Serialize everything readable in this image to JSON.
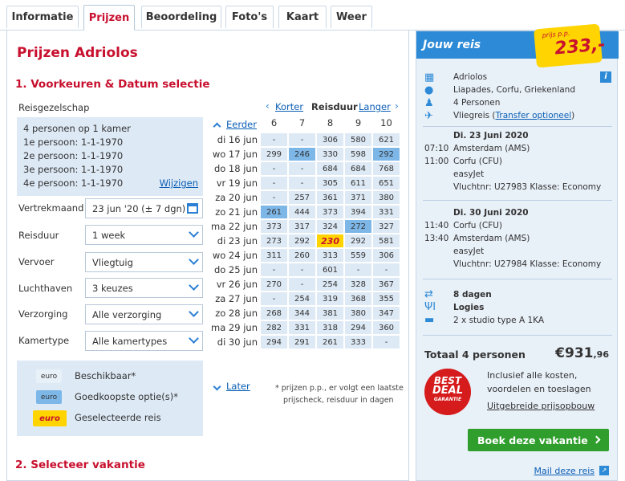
{
  "tabs": [
    {
      "label": "Informatie"
    },
    {
      "label": "Prijzen"
    },
    {
      "label": "Beoordeling"
    },
    {
      "label": "Foto's"
    },
    {
      "label": "Kaart"
    },
    {
      "label": "Weer"
    }
  ],
  "page_title": "Prijzen Adriolos",
  "section1": "1. Voorkeuren & Datum selectie",
  "section2": "2. Selecteer vakantie",
  "reisgezelschap": {
    "label": "Reisgezelschap",
    "line0": "4 personen op 1 kamer",
    "line1": "1e persoon: 1-1-1970",
    "line2": "2e persoon: 1-1-1970",
    "line3": "3e persoon: 1-1-1970",
    "line4": "4e persoon: 1-1-1970",
    "edit": "Wijzigen"
  },
  "fields": [
    {
      "label": "Vertrekmaand",
      "value": "23 jun '20 (± 7 dgn)"
    },
    {
      "label": "Reisduur",
      "value": "1 week"
    },
    {
      "label": "Vervoer",
      "value": "Vliegtuig"
    },
    {
      "label": "Luchthaven",
      "value": "3 keuzes"
    },
    {
      "label": "Verzorging",
      "value": "Alle verzorging"
    },
    {
      "label": "Kamertype",
      "value": "Alle kamertypes"
    }
  ],
  "legend": {
    "chip1": "euro",
    "text1": "Beschikbaar*",
    "chip2": "euro",
    "text2": "Goedkoopste optie(s)*",
    "chip3": "euro",
    "text3": "Geselecteerde reis"
  },
  "grid": {
    "korter": "Korter",
    "reisduur": "Reisduur",
    "langer": "Langer",
    "eerder": "Eerder",
    "later": "Later",
    "cols": [
      "6",
      "7",
      "8",
      "9",
      "10"
    ],
    "rows": [
      {
        "d": "di 16 jun",
        "v": [
          "-",
          "-",
          "306",
          "580",
          "621"
        ]
      },
      {
        "d": "wo 17 jun",
        "v": [
          "299",
          "246",
          "330",
          "598",
          "292"
        ]
      },
      {
        "d": "do 18 jun",
        "v": [
          "-",
          "-",
          "684",
          "684",
          "768"
        ]
      },
      {
        "d": "vr 19 jun",
        "v": [
          "-",
          "-",
          "305",
          "611",
          "651"
        ]
      },
      {
        "d": "za 20 jun",
        "v": [
          "-",
          "257",
          "361",
          "371",
          "380"
        ]
      },
      {
        "d": "zo 21 jun",
        "v": [
          "261",
          "444",
          "373",
          "394",
          "331"
        ]
      },
      {
        "d": "ma 22 jun",
        "v": [
          "373",
          "317",
          "324",
          "272",
          "327"
        ]
      },
      {
        "d": "di 23 jun",
        "v": [
          "273",
          "292",
          "230",
          "292",
          "581"
        ]
      },
      {
        "d": "wo 24 jun",
        "v": [
          "311",
          "260",
          "313",
          "559",
          "306"
        ]
      },
      {
        "d": "do 25 jun",
        "v": [
          "-",
          "-",
          "601",
          "-",
          "-"
        ]
      },
      {
        "d": "vr 26 jun",
        "v": [
          "270",
          "-",
          "254",
          "328",
          "367"
        ]
      },
      {
        "d": "za 27 jun",
        "v": [
          "-",
          "254",
          "319",
          "368",
          "355"
        ]
      },
      {
        "d": "zo 28 jun",
        "v": [
          "268",
          "344",
          "381",
          "380",
          "347"
        ]
      },
      {
        "d": "ma 29 jun",
        "v": [
          "282",
          "331",
          "318",
          "294",
          "360"
        ]
      },
      {
        "d": "di 30 jun",
        "v": [
          "294",
          "291",
          "261",
          "333",
          "-"
        ]
      }
    ],
    "note1": "* prijzen p.p., er volgt een laatste",
    "note2": "prijscheck, reisduur in dagen"
  },
  "side": {
    "title": "Jouw reis",
    "pp": "prijs p.p.",
    "price": "233,-",
    "hotel": "Adriolos",
    "location": "Liapades, Corfu, Griekenland",
    "persons": "4 Personen",
    "flight_prefix": "Vliegreis (",
    "flight_link": "Transfer optioneel",
    "flight_suffix": ")",
    "out": {
      "date": "Di. 23 Juni 2020",
      "t1": "07:10",
      "t2": "11:00",
      "from": "Amsterdam (AMS)",
      "to": "Corfu (CFU)",
      "airline": "easyJet",
      "info": "Vluchtnr: U27983 Klasse: Economy"
    },
    "ret": {
      "date": "Di. 30 Juni 2020",
      "t1": "11:40",
      "t2": "13:40",
      "from": "Corfu (CFU)",
      "to": "Amsterdam (AMS)",
      "airline": "easyJet",
      "info": "Vluchtnr: U27984 Klasse: Economy"
    },
    "days": "8 dagen",
    "board": "Logies",
    "room": "2 x studio type A 1KA",
    "total_label": "Totaal 4 personen",
    "total_main": "€931",
    "total_dec": ",96",
    "incl1": "Inclusief alle kosten,",
    "incl2": "voordelen en toeslagen",
    "breakdown": "Uitgebreide prijsopbouw",
    "deal1": "BEST",
    "deal2": "DEAL",
    "deal3": "GARANTIE",
    "book": "Boek deze vakantie",
    "mail": "Mail deze reis"
  },
  "colors": {
    "accent_red": "#c8102e",
    "blue": "#2d8ad6",
    "green": "#2f9e2c",
    "yellow": "#ffd400"
  }
}
